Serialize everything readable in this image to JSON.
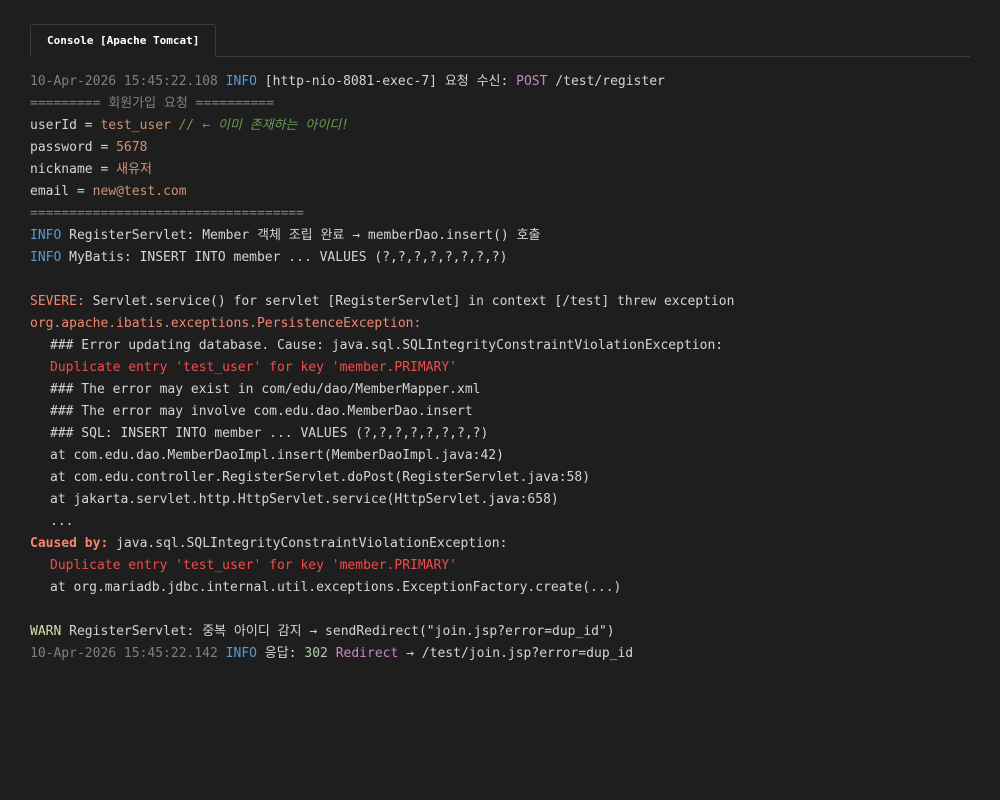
{
  "tab": {
    "label": "Console [Apache Tomcat]"
  },
  "log": {
    "l1": {
      "ts": "10-Apr-2026 15:45:22.108",
      "level": "INFO",
      "thread": " [http-nio-8081-exec-7] 요청 수신: ",
      "method": "POST",
      "path": " /test/register"
    },
    "l2": {
      "text": "========= 회원가입 요청 =========="
    },
    "l3": {
      "key": "userId = ",
      "value": "test_user",
      "comment": " // ← 이미 존재하는 아이디!"
    },
    "l4": {
      "key": "password = ",
      "value": "5678"
    },
    "l5": {
      "key": "nickname = ",
      "value": "새유저"
    },
    "l6": {
      "key": "email = ",
      "value": "new@test.com"
    },
    "l7": {
      "text": "==================================="
    },
    "l8": {
      "level": "INFO",
      "text": " RegisterServlet: Member 객체 조립 완료 → memberDao.insert() 호출"
    },
    "l9": {
      "level": "INFO",
      "text": " MyBatis: INSERT INTO member ... VALUES (?,?,?,?,?,?,?,?)"
    },
    "l10": {
      "level": "SEVERE:",
      "text": " Servlet.service() for servlet [RegisterServlet] in context [/test] threw exception"
    },
    "l11": {
      "text": "org.apache.ibatis.exceptions.PersistenceException:"
    },
    "l12": {
      "text": "### Error updating database. Cause: java.sql.SQLIntegrityConstraintViolationException:"
    },
    "l13": {
      "text": "Duplicate entry 'test_user' for key 'member.PRIMARY'"
    },
    "l14": {
      "text": "### The error may exist in com/edu/dao/MemberMapper.xml"
    },
    "l15": {
      "text": "### The error may involve com.edu.dao.MemberDao.insert"
    },
    "l16": {
      "text": "### SQL: INSERT INTO member ... VALUES (?,?,?,?,?,?,?,?)"
    },
    "l17": {
      "text": "at com.edu.dao.MemberDaoImpl.insert(MemberDaoImpl.java:42)"
    },
    "l18": {
      "text": "at com.edu.controller.RegisterServlet.doPost(RegisterServlet.java:58)"
    },
    "l19": {
      "text": "at jakarta.servlet.http.HttpServlet.service(HttpServlet.java:658)"
    },
    "l20": {
      "text": "..."
    },
    "l21": {
      "label": "Caused by:",
      "text": " java.sql.SQLIntegrityConstraintViolationException:"
    },
    "l22": {
      "text": "Duplicate entry 'test_user' for key 'member.PRIMARY'"
    },
    "l23": {
      "text": "at org.mariadb.jdbc.internal.util.exceptions.ExceptionFactory.create(...)"
    },
    "l24": {
      "level": "WARN",
      "text": " RegisterServlet: 중복 아이디 감지 → sendRedirect(\"join.jsp?error=dup_id\")"
    },
    "l25": {
      "ts": "10-Apr-2026 15:45:22.142",
      "level": "INFO",
      "prefix": " 응답: ",
      "code": "302",
      "status": " Redirect",
      "rest": " → /test/join.jsp?error=dup_id"
    }
  }
}
